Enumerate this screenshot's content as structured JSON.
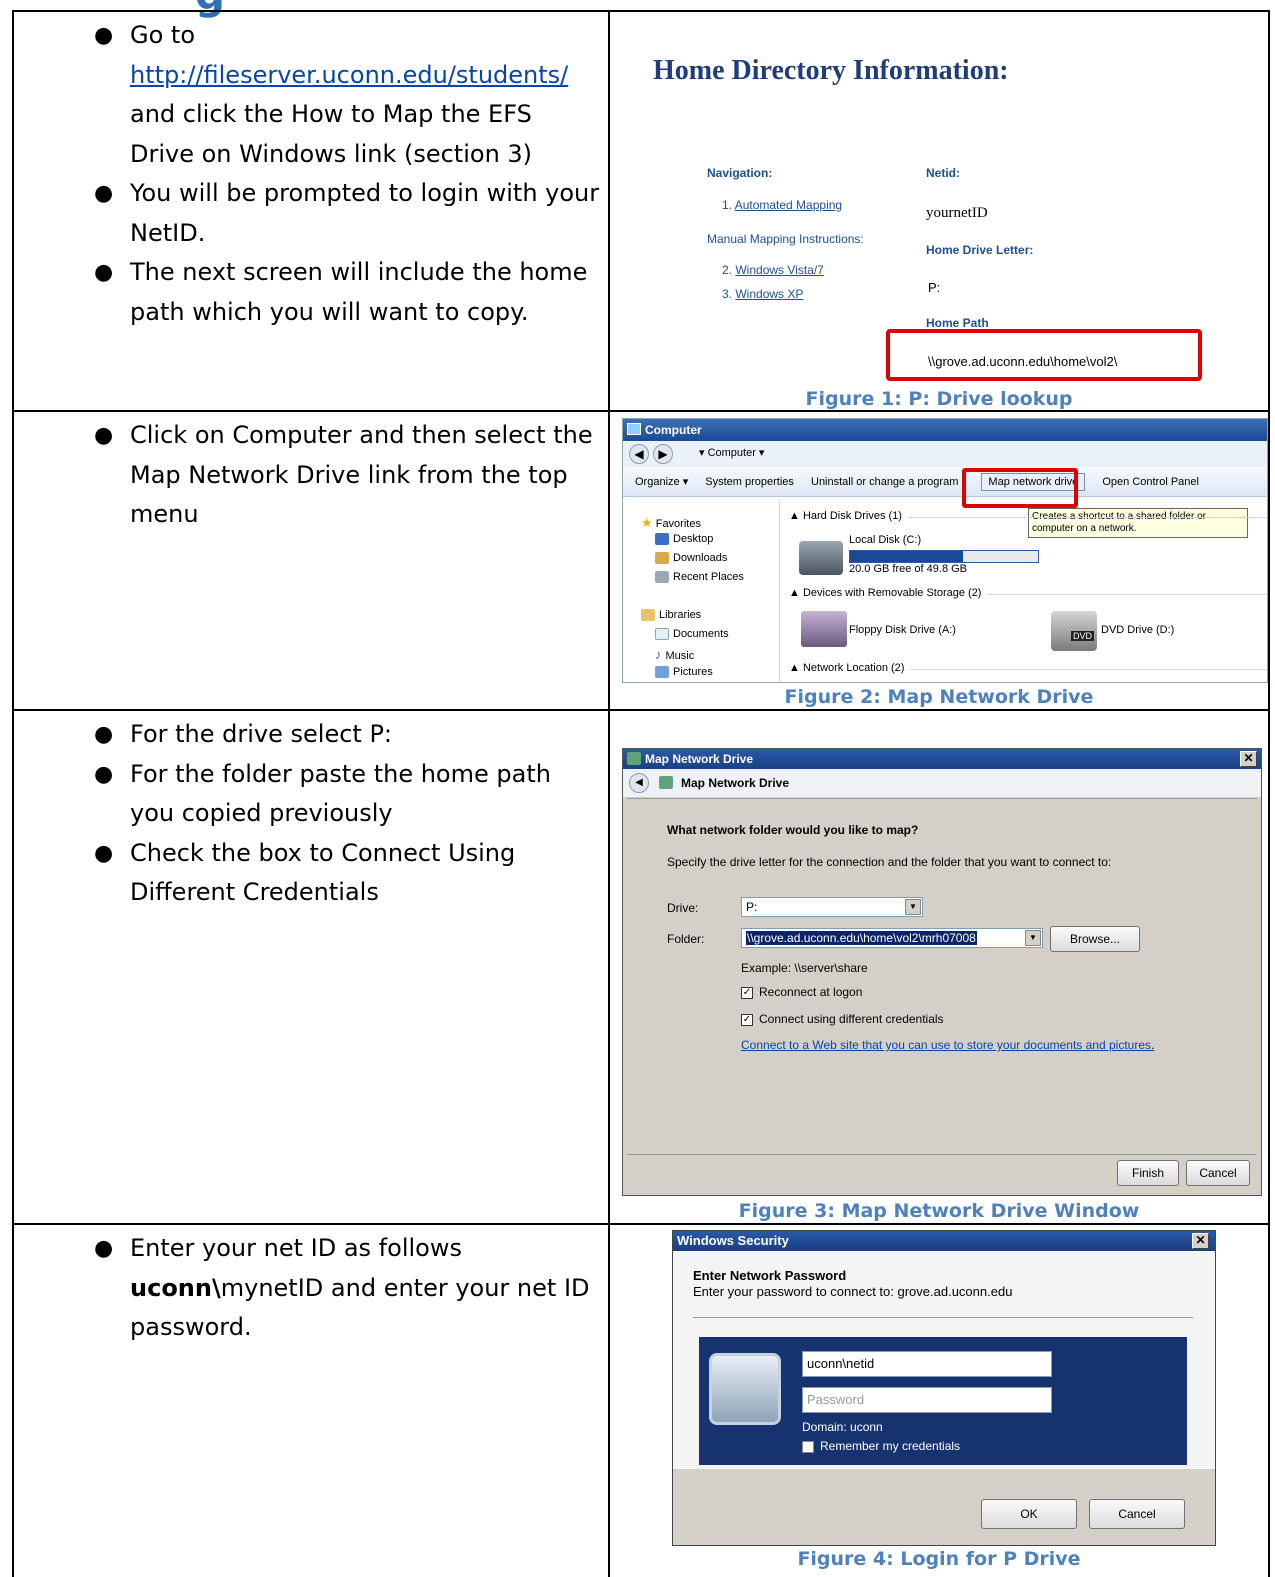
{
  "heading_fragment": "g",
  "rows": [
    {
      "bullets": [
        {
          "pre": "Go to ",
          "link": "http://fileserver.uconn.edu/students/",
          "post": " and click the How to Map the EFS Drive on Windows link (section 3)"
        },
        {
          "text": "You will be prompted to login with your NetID."
        },
        {
          "text": "The next screen will include the home path which you will want to copy."
        }
      ],
      "caption": "Figure 1: P: Drive lookup"
    },
    {
      "bullets": [
        {
          "text": "Click on Computer and then select the Map Network Drive link from the top menu"
        }
      ],
      "caption": "Figure 2: Map Network Drive"
    },
    {
      "bullets": [
        {
          "text": "For the drive select P:"
        },
        {
          "text": "For the folder paste the home path you copied previously"
        },
        {
          "text": "Check the box to Connect Using Different Credentials"
        }
      ],
      "caption": "Figure 3: Map Network Drive Window"
    },
    {
      "bullets": [
        {
          "pre": "Enter your net ID as follows ",
          "bold": "uconn\\",
          "post": "mynetID and enter your net ID password."
        }
      ],
      "caption": "Figure 4: Login for P Drive"
    }
  ],
  "fig1": {
    "title": "Home Directory Information:",
    "navigation_label": "Navigation:",
    "nav1": "1.",
    "nav1_link": "Automated Mapping",
    "manual_label": "Manual Mapping Instructions:",
    "nav2": "2.",
    "nav2_link": "Windows Vista/7",
    "nav3": "3.",
    "nav3_link": "Windows XP",
    "netid_label": "Netid:",
    "netid_value": "yournetID",
    "drive_letter_label": "Home Drive Letter:",
    "drive_letter_value": "P:",
    "home_path_label": "Home Path",
    "home_path_value": "\\\\grove.ad.uconn.edu\\home\\vol2\\"
  },
  "fig2": {
    "window_title": "Computer",
    "address": "Computer",
    "toolbar": [
      "Organize ▾",
      "System properties",
      "Uninstall or change a program",
      "Map network drive",
      "Open Control Panel"
    ],
    "tooltip": "Creates a shortcut to a shared folder or computer on a network.",
    "nav": [
      "Favorites",
      "Desktop",
      "Downloads",
      "Recent Places",
      "Libraries",
      "Documents",
      "Music",
      "Pictures"
    ],
    "hard_disk_group": "Hard Disk Drives (1)",
    "local_disk": "Local Disk (C:)",
    "local_disk_free": "20.0 GB free of 49.8 GB",
    "local_disk_used_fraction": 0.6,
    "removable_group": "Devices with Removable Storage (2)",
    "floppy": "Floppy Disk Drive (A:)",
    "dvd": "DVD Drive (D:)",
    "dvd_badge": "DVD",
    "network_group": "Network Location (2)"
  },
  "fig3": {
    "window_title": "Map Network Drive",
    "inner_title": "Map Network Drive",
    "question": "What network folder would you like to map?",
    "instruction": "Specify the drive letter for the connection and the folder that you want to connect to:",
    "drive_label": "Drive:",
    "drive_value": "P:",
    "folder_label": "Folder:",
    "folder_value": "\\\\grove.ad.uconn.edu\\home\\vol2\\mrh07008",
    "browse": "Browse...",
    "example": "Example: \\\\server\\share",
    "reconnect": "Reconnect at logon",
    "different_creds": "Connect using different credentials",
    "web_link": "Connect to a Web site that you can use to store your documents and pictures",
    "finish": "Finish",
    "cancel": "Cancel"
  },
  "fig4": {
    "window_title": "Windows Security",
    "heading": "Enter Network Password",
    "subheading": "Enter your password to connect to: grove.ad.uconn.edu",
    "username": "uconn\\netid",
    "password_placeholder": "Password",
    "domain": "Domain: uconn",
    "remember": "Remember my credentials",
    "ok": "OK",
    "cancel": "Cancel"
  },
  "colors": {
    "caption": "#4f81bd",
    "link": "#0645ad",
    "highlight": "#e00000",
    "dialog_blue": "#17336f"
  }
}
